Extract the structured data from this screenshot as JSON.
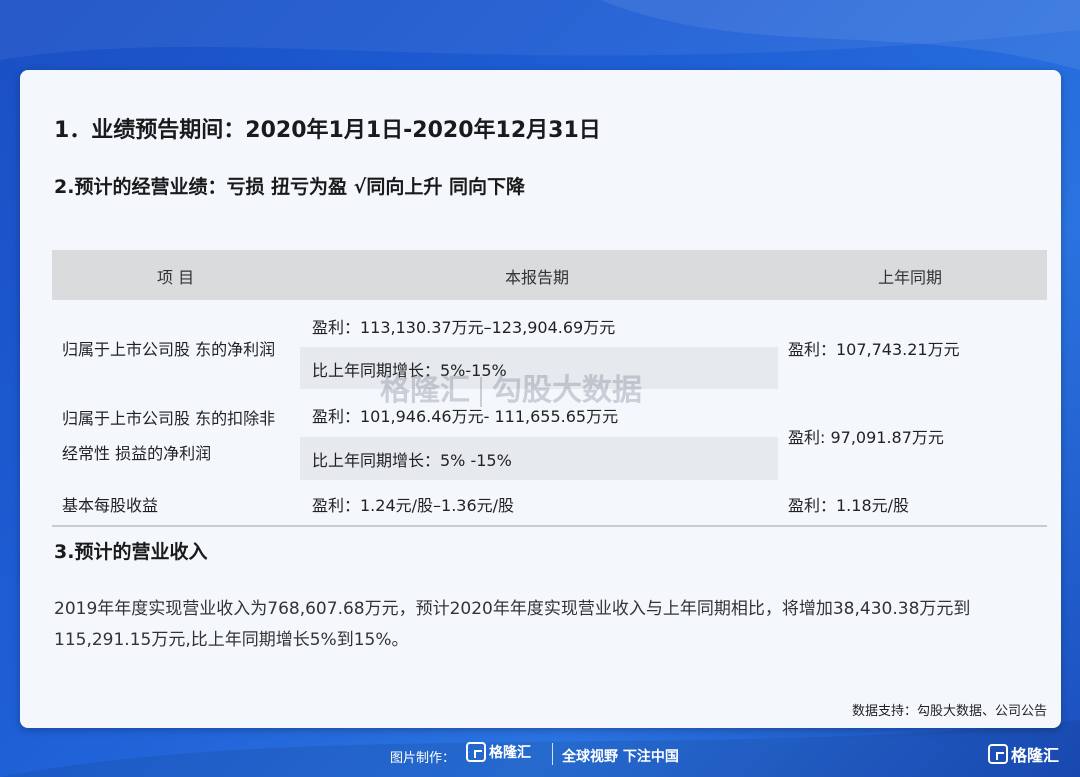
{
  "heading1": "1．业绩预告期间：2020年1月1日-2020年12月31日",
  "heading2": "2.预计的经营业绩：亏损 扭亏为盈 √同向上升 同向下降",
  "table": {
    "headers": [
      "项 目",
      "本报告期",
      "上年同期"
    ],
    "rows": [
      {
        "item": "归属于上市公司股 东的净利润",
        "current_1": "盈利：113,130.37万元–123,904.69万元",
        "current_2": "比上年同期增长：5%-15%",
        "previous": "盈利：107,743.21万元"
      },
      {
        "item_line1": "归属于上市公司股 东的扣除非",
        "item_line2": "经常性 损益的净利润",
        "current_1": "盈利：101,946.46万元- 111,655.65万元",
        "current_2": "比上年同期增长：5% -15%",
        "previous": "盈利: 97,091.87万元"
      },
      {
        "item": "基本每股收益",
        "current_1": "盈利：1.24元/股–1.36元/股",
        "previous": "盈利：1.18元/股"
      }
    ]
  },
  "heading3": "3.预计的营业收入",
  "paragraph": "2019年年度实现营业收入为768,607.68万元，预计2020年年度实现营业收入与上年同期相比，将增加38,430.38万元到115,291.15万元,比上年同期增长5%到15%。",
  "watermark": {
    "brand": "格隆汇",
    "product": "勾股大数据"
  },
  "source": "数据支持：勾股大数据、公司公告",
  "footer": {
    "made_by": "图片制作：",
    "logo_text": "格隆汇",
    "slogan": "全球视野 下注中国"
  },
  "corner_logo": "格隆汇",
  "colors": {
    "background": "#1e5fd6",
    "card": "#f4f8fd",
    "header_row": "#d9dbdd",
    "shaded_row": "#e6e9ed"
  }
}
